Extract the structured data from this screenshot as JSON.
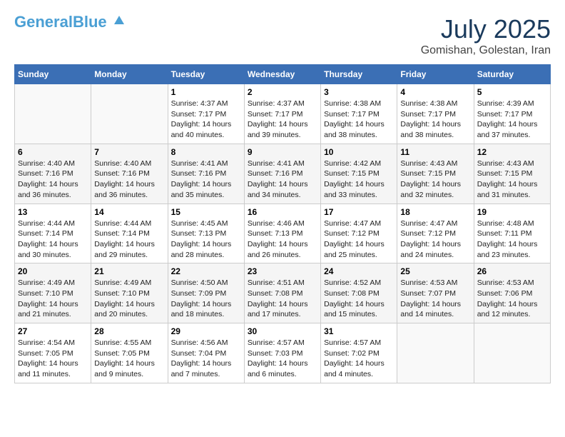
{
  "header": {
    "logo_general": "General",
    "logo_blue": "Blue",
    "month": "July 2025",
    "location": "Gomishan, Golestan, Iran"
  },
  "weekdays": [
    "Sunday",
    "Monday",
    "Tuesday",
    "Wednesday",
    "Thursday",
    "Friday",
    "Saturday"
  ],
  "weeks": [
    [
      {
        "day": "",
        "sunrise": "",
        "sunset": "",
        "daylight": ""
      },
      {
        "day": "",
        "sunrise": "",
        "sunset": "",
        "daylight": ""
      },
      {
        "day": "1",
        "sunrise": "Sunrise: 4:37 AM",
        "sunset": "Sunset: 7:17 PM",
        "daylight": "Daylight: 14 hours and 40 minutes."
      },
      {
        "day": "2",
        "sunrise": "Sunrise: 4:37 AM",
        "sunset": "Sunset: 7:17 PM",
        "daylight": "Daylight: 14 hours and 39 minutes."
      },
      {
        "day": "3",
        "sunrise": "Sunrise: 4:38 AM",
        "sunset": "Sunset: 7:17 PM",
        "daylight": "Daylight: 14 hours and 38 minutes."
      },
      {
        "day": "4",
        "sunrise": "Sunrise: 4:38 AM",
        "sunset": "Sunset: 7:17 PM",
        "daylight": "Daylight: 14 hours and 38 minutes."
      },
      {
        "day": "5",
        "sunrise": "Sunrise: 4:39 AM",
        "sunset": "Sunset: 7:17 PM",
        "daylight": "Daylight: 14 hours and 37 minutes."
      }
    ],
    [
      {
        "day": "6",
        "sunrise": "Sunrise: 4:40 AM",
        "sunset": "Sunset: 7:16 PM",
        "daylight": "Daylight: 14 hours and 36 minutes."
      },
      {
        "day": "7",
        "sunrise": "Sunrise: 4:40 AM",
        "sunset": "Sunset: 7:16 PM",
        "daylight": "Daylight: 14 hours and 36 minutes."
      },
      {
        "day": "8",
        "sunrise": "Sunrise: 4:41 AM",
        "sunset": "Sunset: 7:16 PM",
        "daylight": "Daylight: 14 hours and 35 minutes."
      },
      {
        "day": "9",
        "sunrise": "Sunrise: 4:41 AM",
        "sunset": "Sunset: 7:16 PM",
        "daylight": "Daylight: 14 hours and 34 minutes."
      },
      {
        "day": "10",
        "sunrise": "Sunrise: 4:42 AM",
        "sunset": "Sunset: 7:15 PM",
        "daylight": "Daylight: 14 hours and 33 minutes."
      },
      {
        "day": "11",
        "sunrise": "Sunrise: 4:43 AM",
        "sunset": "Sunset: 7:15 PM",
        "daylight": "Daylight: 14 hours and 32 minutes."
      },
      {
        "day": "12",
        "sunrise": "Sunrise: 4:43 AM",
        "sunset": "Sunset: 7:15 PM",
        "daylight": "Daylight: 14 hours and 31 minutes."
      }
    ],
    [
      {
        "day": "13",
        "sunrise": "Sunrise: 4:44 AM",
        "sunset": "Sunset: 7:14 PM",
        "daylight": "Daylight: 14 hours and 30 minutes."
      },
      {
        "day": "14",
        "sunrise": "Sunrise: 4:44 AM",
        "sunset": "Sunset: 7:14 PM",
        "daylight": "Daylight: 14 hours and 29 minutes."
      },
      {
        "day": "15",
        "sunrise": "Sunrise: 4:45 AM",
        "sunset": "Sunset: 7:13 PM",
        "daylight": "Daylight: 14 hours and 28 minutes."
      },
      {
        "day": "16",
        "sunrise": "Sunrise: 4:46 AM",
        "sunset": "Sunset: 7:13 PM",
        "daylight": "Daylight: 14 hours and 26 minutes."
      },
      {
        "day": "17",
        "sunrise": "Sunrise: 4:47 AM",
        "sunset": "Sunset: 7:12 PM",
        "daylight": "Daylight: 14 hours and 25 minutes."
      },
      {
        "day": "18",
        "sunrise": "Sunrise: 4:47 AM",
        "sunset": "Sunset: 7:12 PM",
        "daylight": "Daylight: 14 hours and 24 minutes."
      },
      {
        "day": "19",
        "sunrise": "Sunrise: 4:48 AM",
        "sunset": "Sunset: 7:11 PM",
        "daylight": "Daylight: 14 hours and 23 minutes."
      }
    ],
    [
      {
        "day": "20",
        "sunrise": "Sunrise: 4:49 AM",
        "sunset": "Sunset: 7:10 PM",
        "daylight": "Daylight: 14 hours and 21 minutes."
      },
      {
        "day": "21",
        "sunrise": "Sunrise: 4:49 AM",
        "sunset": "Sunset: 7:10 PM",
        "daylight": "Daylight: 14 hours and 20 minutes."
      },
      {
        "day": "22",
        "sunrise": "Sunrise: 4:50 AM",
        "sunset": "Sunset: 7:09 PM",
        "daylight": "Daylight: 14 hours and 18 minutes."
      },
      {
        "day": "23",
        "sunrise": "Sunrise: 4:51 AM",
        "sunset": "Sunset: 7:08 PM",
        "daylight": "Daylight: 14 hours and 17 minutes."
      },
      {
        "day": "24",
        "sunrise": "Sunrise: 4:52 AM",
        "sunset": "Sunset: 7:08 PM",
        "daylight": "Daylight: 14 hours and 15 minutes."
      },
      {
        "day": "25",
        "sunrise": "Sunrise: 4:53 AM",
        "sunset": "Sunset: 7:07 PM",
        "daylight": "Daylight: 14 hours and 14 minutes."
      },
      {
        "day": "26",
        "sunrise": "Sunrise: 4:53 AM",
        "sunset": "Sunset: 7:06 PM",
        "daylight": "Daylight: 14 hours and 12 minutes."
      }
    ],
    [
      {
        "day": "27",
        "sunrise": "Sunrise: 4:54 AM",
        "sunset": "Sunset: 7:05 PM",
        "daylight": "Daylight: 14 hours and 11 minutes."
      },
      {
        "day": "28",
        "sunrise": "Sunrise: 4:55 AM",
        "sunset": "Sunset: 7:05 PM",
        "daylight": "Daylight: 14 hours and 9 minutes."
      },
      {
        "day": "29",
        "sunrise": "Sunrise: 4:56 AM",
        "sunset": "Sunset: 7:04 PM",
        "daylight": "Daylight: 14 hours and 7 minutes."
      },
      {
        "day": "30",
        "sunrise": "Sunrise: 4:57 AM",
        "sunset": "Sunset: 7:03 PM",
        "daylight": "Daylight: 14 hours and 6 minutes."
      },
      {
        "day": "31",
        "sunrise": "Sunrise: 4:57 AM",
        "sunset": "Sunset: 7:02 PM",
        "daylight": "Daylight: 14 hours and 4 minutes."
      },
      {
        "day": "",
        "sunrise": "",
        "sunset": "",
        "daylight": ""
      },
      {
        "day": "",
        "sunrise": "",
        "sunset": "",
        "daylight": ""
      }
    ]
  ]
}
